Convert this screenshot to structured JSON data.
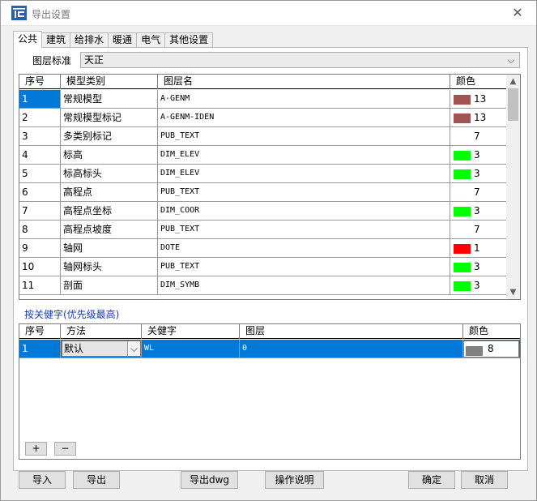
{
  "title": "导出设置",
  "tabs": [
    "公共",
    "建筑",
    "给排水",
    "暖通",
    "电气",
    "其他设置"
  ],
  "active_tab": 0,
  "layer_standard": {
    "label": "图层标准",
    "value": "天正"
  },
  "model_table": {
    "headers": [
      "序号",
      "模型类别",
      "图层名",
      "颜色"
    ],
    "rows": [
      {
        "no": "1",
        "category": "常规模型",
        "layer": "A-GENM",
        "color": "#a05454",
        "color_no": "13"
      },
      {
        "no": "2",
        "category": "常规模型标记",
        "layer": "A-GENM-IDEN",
        "color": "#a05454",
        "color_no": "13"
      },
      {
        "no": "3",
        "category": "多类别标记",
        "layer": "PUB_TEXT",
        "color": "",
        "color_no": "7"
      },
      {
        "no": "4",
        "category": "标高",
        "layer": "DIM_ELEV",
        "color": "#00ff00",
        "color_no": "3"
      },
      {
        "no": "5",
        "category": "标高标头",
        "layer": "DIM_ELEV",
        "color": "#00ff00",
        "color_no": "3"
      },
      {
        "no": "6",
        "category": "高程点",
        "layer": "PUB_TEXT",
        "color": "",
        "color_no": "7"
      },
      {
        "no": "7",
        "category": "高程点坐标",
        "layer": "DIM_COOR",
        "color": "#00ff00",
        "color_no": "3"
      },
      {
        "no": "8",
        "category": "高程点坡度",
        "layer": "PUB_TEXT",
        "color": "",
        "color_no": "7"
      },
      {
        "no": "9",
        "category": "轴网",
        "layer": "DOTE",
        "color": "#ff0000",
        "color_no": "1"
      },
      {
        "no": "10",
        "category": "轴网标头",
        "layer": "PUB_TEXT",
        "color": "#00ff00",
        "color_no": "3"
      },
      {
        "no": "11",
        "category": "剖面",
        "layer": "DIM_SYMB",
        "color": "#00ff00",
        "color_no": "3"
      }
    ],
    "selected_row": 0
  },
  "keyword_section": {
    "label": "按关健字(优先级最高)",
    "headers": [
      "序号",
      "方法",
      "关健字",
      "图层",
      "颜色"
    ],
    "rows": [
      {
        "no": "1",
        "method": "默认",
        "keyword": "WL",
        "layer": "0",
        "color": "#808080",
        "color_no": "8"
      }
    ]
  },
  "small_buttons": {
    "add": "+",
    "remove": "−"
  },
  "buttons": {
    "import": "导入",
    "export": "导出",
    "export_dwg": "导出dwg",
    "help": "操作说明",
    "ok": "确定",
    "cancel": "取消"
  },
  "icons": {
    "app": "tce-logo-icon",
    "close": "close-icon",
    "dropdown": "chevron-down-icon",
    "scroll_up": "scroll-up-icon",
    "scroll_down": "scroll-down-icon"
  }
}
